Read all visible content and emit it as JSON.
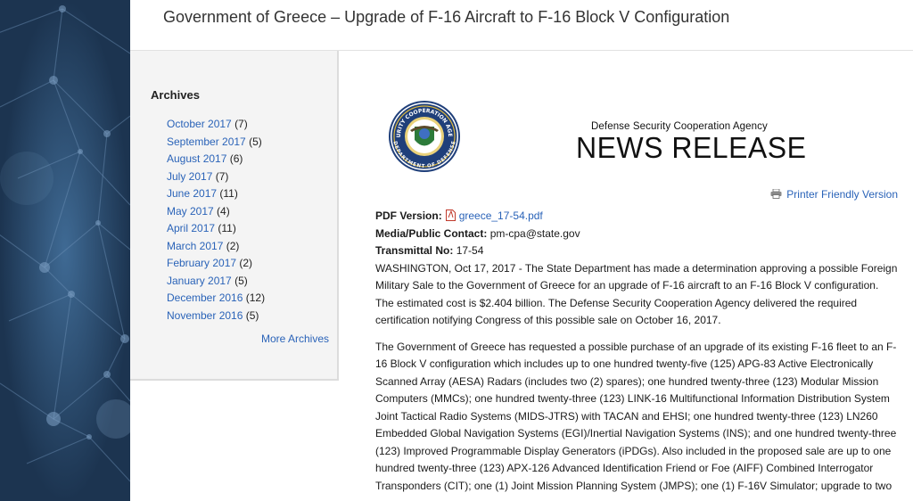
{
  "page_title": "Government of Greece – Upgrade of F-16 Aircraft to F-16 Block V Configuration",
  "sidebar": {
    "heading": "Archives",
    "items": [
      {
        "label": "October 2017",
        "count": "(7)"
      },
      {
        "label": "September 2017",
        "count": "(5)"
      },
      {
        "label": "August 2017",
        "count": "(6)"
      },
      {
        "label": "July 2017",
        "count": "(7)"
      },
      {
        "label": "June 2017",
        "count": "(11)"
      },
      {
        "label": "May 2017",
        "count": "(4)"
      },
      {
        "label": "April 2017",
        "count": "(11)"
      },
      {
        "label": "March 2017",
        "count": "(2)"
      },
      {
        "label": "February 2017",
        "count": "(2)"
      },
      {
        "label": "January 2017",
        "count": "(5)"
      },
      {
        "label": "December 2016",
        "count": "(12)"
      },
      {
        "label": "November 2016",
        "count": "(5)"
      }
    ],
    "more_label": "More Archives"
  },
  "masthead": {
    "seal_top_text": "SECURITY COOPERATION AGENCY",
    "seal_bottom_text": "DEPARTMENT OF DEFENSE",
    "agency": "Defense Security Cooperation Agency",
    "release": "NEWS RELEASE"
  },
  "printer_label": "Printer Friendly Version",
  "meta": {
    "pdf_label": "PDF Version:",
    "pdf_file": "greece_17-54.pdf",
    "contact_label": "Media/Public Contact:",
    "contact_value": "pm-cpa@state.gov",
    "transmittal_label": "Transmittal No:",
    "transmittal_value": "17-54"
  },
  "paragraphs": [
    "WASHINGTON, Oct 17, 2017 - The State Department has made a determination approving a possible Foreign Military Sale to the Government of Greece for an upgrade of F-16 aircraft to an F-16 Block V configuration. The estimated cost is $2.404 billion.  The Defense Security Cooperation Agency delivered the required certification notifying Congress of this possible sale on October 16, 2017.",
    "The Government of Greece has requested a possible purchase of an upgrade of its existing F-16 fleet to an F-16 Block V configuration which includes up to one hundred twenty-five (125) APG-83 Active Electronically Scanned Array (AESA) Radars (includes two (2) spares); one hundred twenty-three (123) Modular Mission Computers (MMCs); one hundred twenty-three (123) LINK-16 Multifunctional Information Distribution System Joint Tactical Radio Systems (MIDS-JTRS) with TACAN and EHSI; one hundred twenty-three (123) LN260 Embedded Global Navigation Systems (EGI)/Inertial Navigation Systems (INS); and one hundred twenty-three (123) Improved Programmable Display Generators (iPDGs).  Also included in the proposed sale are up to one hundred twenty-three (123) APX-126 Advanced Identification Friend or Foe (AIFF) Combined Interrogator Transponders (CIT); one (1) Joint Mission Planning System (JMPS); one (1) F-16V Simulator; upgrade to two"
  ]
}
